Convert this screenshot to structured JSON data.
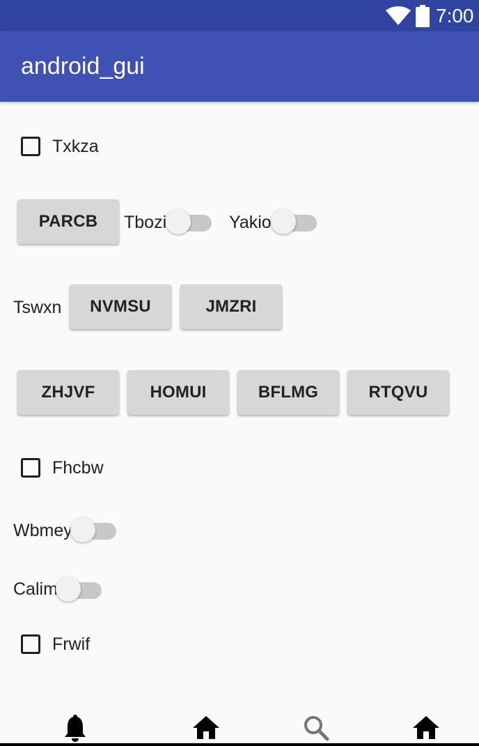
{
  "status_bar": {
    "time": "7:00",
    "icons": [
      "wifi-icon",
      "battery-icon"
    ]
  },
  "app_bar": {
    "title": "android_gui"
  },
  "checkboxes": [
    {
      "label": "Txkza",
      "checked": false
    },
    {
      "label": "Fhcbw",
      "checked": false
    },
    {
      "label": "Frwif",
      "checked": false
    }
  ],
  "buttons": {
    "parcb": "PARCB",
    "nvmsu": "NVMSU",
    "jmzri": "JMZRI",
    "zhjvf": "ZHJVF",
    "homui": "HOMUI",
    "bflmg": "BFLMG",
    "rtqvu": "RTQVU"
  },
  "labels": {
    "tswxn": "Tswxn"
  },
  "switches": [
    {
      "label": "Tbozi",
      "on": false
    },
    {
      "label": "Yakio",
      "on": false
    },
    {
      "label": "Wbmey",
      "on": false
    },
    {
      "label": "Calim",
      "on": false
    }
  ],
  "bottom_nav": {
    "icons": [
      "bell-icon",
      "home-icon",
      "search-icon",
      "home-icon"
    ]
  },
  "colors": {
    "status_bar": "#3045a1",
    "app_bar": "#3f51b5",
    "background": "#fafafa",
    "button": "#d7d7d7",
    "switch_track": "#c8c8c8"
  }
}
